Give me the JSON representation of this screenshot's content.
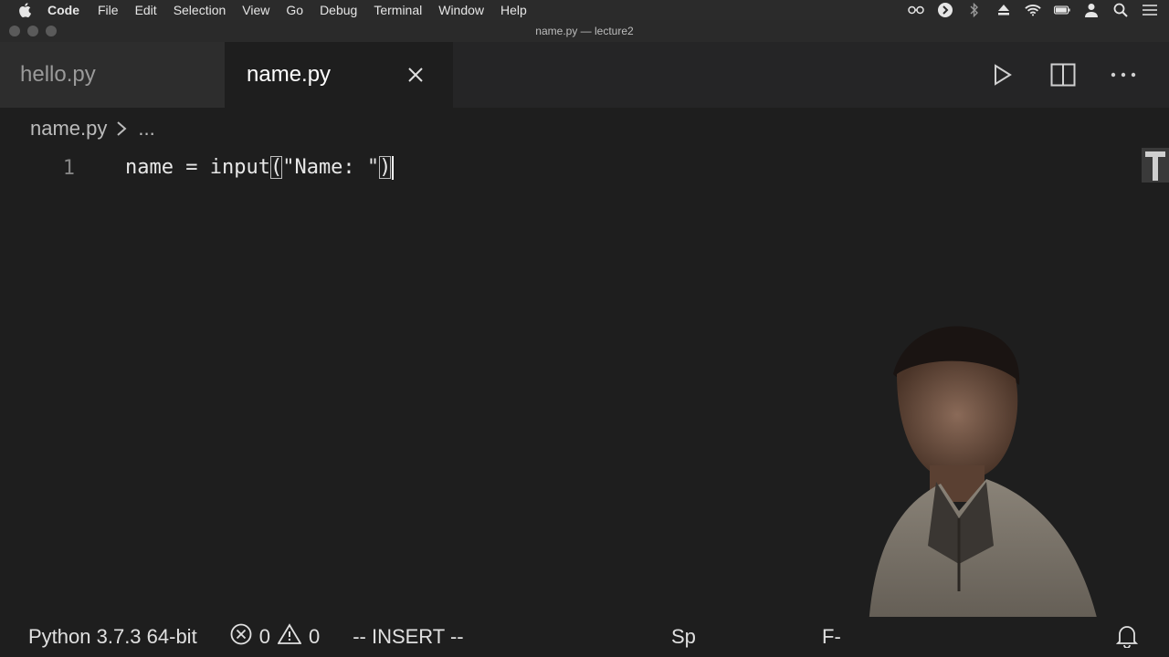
{
  "menubar": {
    "app_name": "Code",
    "items": [
      "File",
      "Edit",
      "Selection",
      "View",
      "Go",
      "Debug",
      "Terminal",
      "Window",
      "Help"
    ],
    "status_icons": [
      "glasses-icon",
      "dark-circle-icon",
      "bluetooth-icon",
      "eject-icon",
      "wifi-icon",
      "battery-icon",
      "user-icon",
      "search-icon",
      "list-icon"
    ]
  },
  "window": {
    "title": "name.py — lecture2"
  },
  "tabs": [
    {
      "label": "hello.py",
      "active": false
    },
    {
      "label": "name.py",
      "active": true
    }
  ],
  "breadcrumb": {
    "file": "name.py",
    "ellipsis": "..."
  },
  "editor": {
    "lines": [
      {
        "number": "1",
        "before": "name = input",
        "open_paren": "(",
        "string": "\"Name: \"",
        "close_paren": ")"
      }
    ]
  },
  "statusbar": {
    "interpreter": "Python 3.7.3 64-bit",
    "errors": "0",
    "warnings": "0",
    "mode": "-- INSERT --",
    "spaces_partial": "Sp",
    "encoding_partial": "F-"
  },
  "colors": {
    "editor_bg": "#1e1e1e",
    "tab_inactive_bg": "#2d2d2d",
    "string": "#e8e8e8",
    "line_number": "#858585"
  }
}
